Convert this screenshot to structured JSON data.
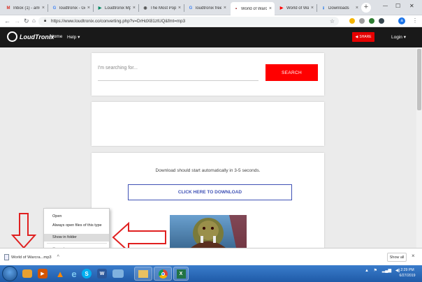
{
  "browser": {
    "tabs": [
      {
        "label": "Inbox (1) - amu",
        "icon": "gmail-icon",
        "favcolor": "#d93025",
        "favtext": "M"
      },
      {
        "label": "loudtronix - Go",
        "icon": "google-icon",
        "favcolor": "#4285f4",
        "favtext": "G"
      },
      {
        "label": "Loudtronix Mp",
        "icon": "play-icon",
        "favcolor": "#01875f",
        "favtext": "▶"
      },
      {
        "label": "The Most Popu",
        "icon": "globe-icon",
        "favcolor": "#555555",
        "favtext": "◉"
      },
      {
        "label": "loudtronix free",
        "icon": "google-icon",
        "favcolor": "#4285f4",
        "favtext": "G"
      },
      {
        "label": "World of Warcr",
        "icon": "site-icon",
        "favcolor": "#8b0000",
        "favtext": "▪",
        "active": true
      },
      {
        "label": "World of Warc",
        "icon": "youtube-icon",
        "favcolor": "#ff0000",
        "favtext": "▶"
      },
      {
        "label": "Downloads",
        "icon": "download-icon",
        "favcolor": "#1a73e8",
        "favtext": "⭳"
      }
    ],
    "tab_close": "×",
    "new_tab": "+",
    "window_controls": {
      "minimize": "—",
      "maximize": "☐",
      "close": "✕"
    },
    "url": "https://www.loudtronix.co/converting.php?v=DrHdX81ztUQ&fmt=mp3",
    "profile_letter": "a"
  },
  "site": {
    "logo": "LoudTronix",
    "nav": [
      "Home",
      "Help ▾"
    ],
    "share_label": "SHARE",
    "login_label": "Login ▾",
    "search_placeholder": "I'm searching for...",
    "search_button": "SEARCH",
    "download_message": "Download should start automatically in 3-5 seconds.",
    "download_button": "CLICK HERE TO DOWNLOAD"
  },
  "context_menu": {
    "items": [
      "Open",
      "Always open files of this type",
      "Show in folder",
      "Cancel"
    ],
    "highlighted": "Show in folder",
    "disabled": "Cancel"
  },
  "download_shelf": {
    "filename": "World of Warcra...mp3",
    "show_all": "Show all",
    "close": "×"
  },
  "taskbar": {
    "time": "2:29 PM",
    "date": "6/27/2019",
    "apps": [
      "folder-icon",
      "media-player-icon",
      "vlc-icon",
      "ie-icon",
      "skype-icon",
      "word-icon",
      "window-icon",
      "explorer-icon",
      "chrome-icon",
      "excel-icon"
    ]
  },
  "colors": {
    "accent_red": "#ff0000",
    "nav_dark": "#191919",
    "download_blue": "#3f51b5",
    "annotation_red": "#e02020"
  }
}
